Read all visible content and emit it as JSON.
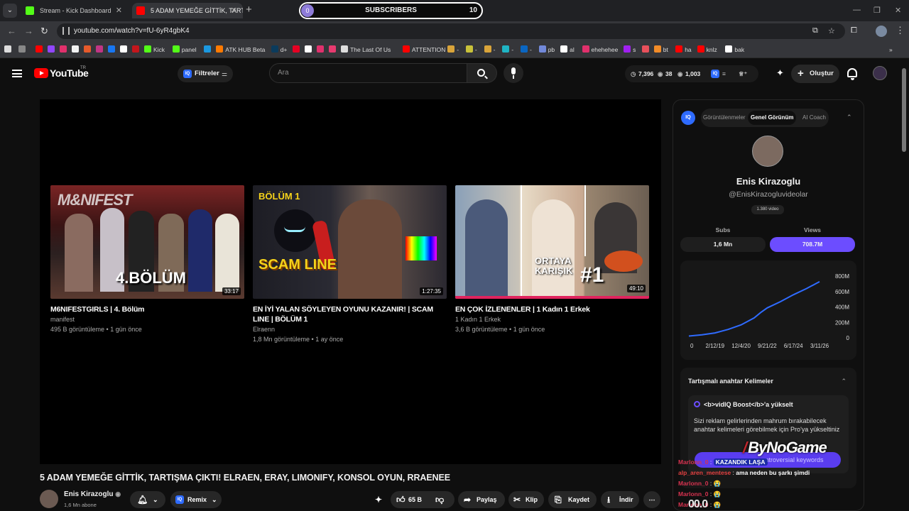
{
  "browser": {
    "tabs": [
      {
        "label": "Stream - Kick Dashboard",
        "color": "#53fc18"
      },
      {
        "label": "5 ADAM YEMEĞE GİTTİK, TARTI",
        "color": "#ff0000"
      }
    ],
    "url": "youtube.com/watch?v=fU-6yR4gbK4"
  },
  "sub_overlay": {
    "counter": "0",
    "label": "SUBSCRIBERS",
    "goal": "10"
  },
  "bookmarks": [
    {
      "label": "",
      "color": "#ff0000"
    },
    {
      "label": "",
      "color": "#9146ff"
    },
    {
      "label": "",
      "color": "#e1306c"
    },
    {
      "label": "",
      "color": "#f2f2f2"
    },
    {
      "label": "",
      "color": "#e65a2b"
    },
    {
      "label": "",
      "color": "#c13584"
    },
    {
      "label": "",
      "color": "#1877f2"
    },
    {
      "label": "",
      "color": "#ffffff"
    },
    {
      "label": "",
      "color": "#c4161c"
    },
    {
      "label": "Kick",
      "color": "#53fc18"
    },
    {
      "label": "panel",
      "color": "#53fc18"
    },
    {
      "label": "",
      "color": "#1b98e0"
    },
    {
      "label": "ATK HUB Beta",
      "color": "#ff7a00"
    },
    {
      "label": "d+",
      "color": "#0b3b5c"
    },
    {
      "label": "",
      "color": "#e60023"
    },
    {
      "label": "",
      "color": "#ffffff"
    },
    {
      "label": "",
      "color": "#e1306c"
    },
    {
      "label": "",
      "color": "#e83a6f"
    },
    {
      "label": "The Last Of Us",
      "color": "#dddddd"
    },
    {
      "label": "ATTENTION",
      "color": "#ff0000"
    },
    {
      "label": "-",
      "color": "#d9a43a"
    },
    {
      "label": "-",
      "color": "#c9c23a"
    },
    {
      "label": "-",
      "color": "#d9a43a"
    },
    {
      "label": "-",
      "color": "#1fb4c4"
    },
    {
      "label": "-",
      "color": "#0a66c2"
    },
    {
      "label": "pb",
      "color": "#7289da"
    },
    {
      "label": "al",
      "color": "#ffffff"
    },
    {
      "label": "ehehehee",
      "color": "#e1306c"
    },
    {
      "label": "s",
      "color": "#a020f0"
    },
    {
      "label": "",
      "color": "#e8505b"
    },
    {
      "label": "bt",
      "color": "#f28c28"
    },
    {
      "label": "ha",
      "color": "#ff0000"
    },
    {
      "label": "knlz",
      "color": "#ff0000"
    },
    {
      "label": "bak",
      "color": "#ffffff"
    }
  ],
  "youtube": {
    "logo": "YouTube",
    "country": "TR",
    "filters_label": "Filtreler",
    "search_placeholder": "Ara",
    "stats": {
      "a": "7,396",
      "b": "38",
      "c": "1,003"
    },
    "create_label": "Oluştur"
  },
  "end_screen": [
    {
      "title": "M6NIFESTGIRLS | 4. Bölüm",
      "channel": "manifest",
      "meta": "495 B görüntüleme • 1 gün önce",
      "duration": "33:17",
      "overlay": "4.BÖLÜM"
    },
    {
      "title": "EN İYİ YALAN SÖYLEYEN OYUNU KAZANIR! | SCAM LINE | BÖLÜM 1",
      "channel": "Elraenn",
      "meta": "1,8 Mn görüntüleme • 1 ay önce",
      "duration": "1:27:35",
      "overlay_top": "BÖLÜM 1",
      "overlay": "SCAM LINE"
    },
    {
      "title": "EN ÇOK İZLENENLER | 1 Kadın 1 Erkek",
      "channel": "1 Kadın 1 Erkek",
      "meta": "3,6 B görüntüleme • 1 gün önce",
      "duration": "49:10",
      "overlay": "ORTAYA KARIŞIK",
      "overlay_num": "#1"
    }
  ],
  "video": {
    "title": "5 ADAM YEMEĞE GİTTİK, TARTIŞMA ÇIKTI! ELRAEN, ERAY, LIMONIFY, KONSOL OYUN, RRAENEE",
    "channel": "Enis Kirazoglu",
    "subscribers": "1,6 Mn abone",
    "remix": "Remix",
    "likes": "65 B",
    "share": "Paylaş",
    "clip": "Klip",
    "save": "Kaydet",
    "download": "İndir"
  },
  "vidiq": {
    "tabs": [
      "Görüntülenmeler",
      "Genel Görünüm",
      "AI Coach"
    ],
    "active_tab": "Genel Görünüm",
    "name": "Enis Kirazoglu",
    "handle": "@EnisKirazogluvideolar",
    "videos": "1.380 video",
    "subs_label": "Subs",
    "subs_value": "1,6 Mn",
    "views_label": "Views",
    "views_value": "708.7M",
    "accent": "#6c4dff",
    "keywords_title": "Tartışmalı anahtar Kelimeler",
    "boost_label": "<b>vidIQ Boost</b>'a yükselt",
    "keywords_desc": "Sizi reklam gelirlerinden mahrum bırakabilecek anahtar kelimeleri görebilmek için Pro'ya yükseltiniz",
    "upgrade_btn": "controversial keywords"
  },
  "chart_data": {
    "type": "line",
    "title": "",
    "xlabel": "",
    "ylabel": "",
    "x_ticks": [
      "0",
      "2/12/19",
      "12/4/20",
      "9/21/22",
      "6/17/24",
      "3/11/26"
    ],
    "y_ticks": [
      "800M",
      "600M",
      "400M",
      "200M",
      "0"
    ],
    "ylim": [
      0,
      800
    ],
    "x": [
      0,
      0.1,
      0.2,
      0.3,
      0.4,
      0.5,
      0.55,
      0.6,
      0.7,
      0.8,
      0.9,
      1.0
    ],
    "y": [
      5,
      20,
      45,
      90,
      150,
      240,
      310,
      370,
      450,
      540,
      620,
      709
    ],
    "series_color": "#2f6bff",
    "grid": false
  },
  "overlays": {
    "brand": "ByNoGame",
    "chat": [
      {
        "user": "Marlonn_0",
        "msg": "KAZANDIK LAŞA",
        "highlight": true
      },
      {
        "user": "alp_aren_mentese",
        "msg": "ama neden bu şarkı şimdi",
        "highlight": false
      },
      {
        "user": "Marlonn_0",
        "msg": "😭",
        "highlight": false
      },
      {
        "user": "Marlonn_0",
        "msg": "😭",
        "highlight": false
      },
      {
        "user": "Marlonn_0",
        "msg": "😭",
        "highlight": false
      }
    ],
    "big_counter": "00.0"
  }
}
